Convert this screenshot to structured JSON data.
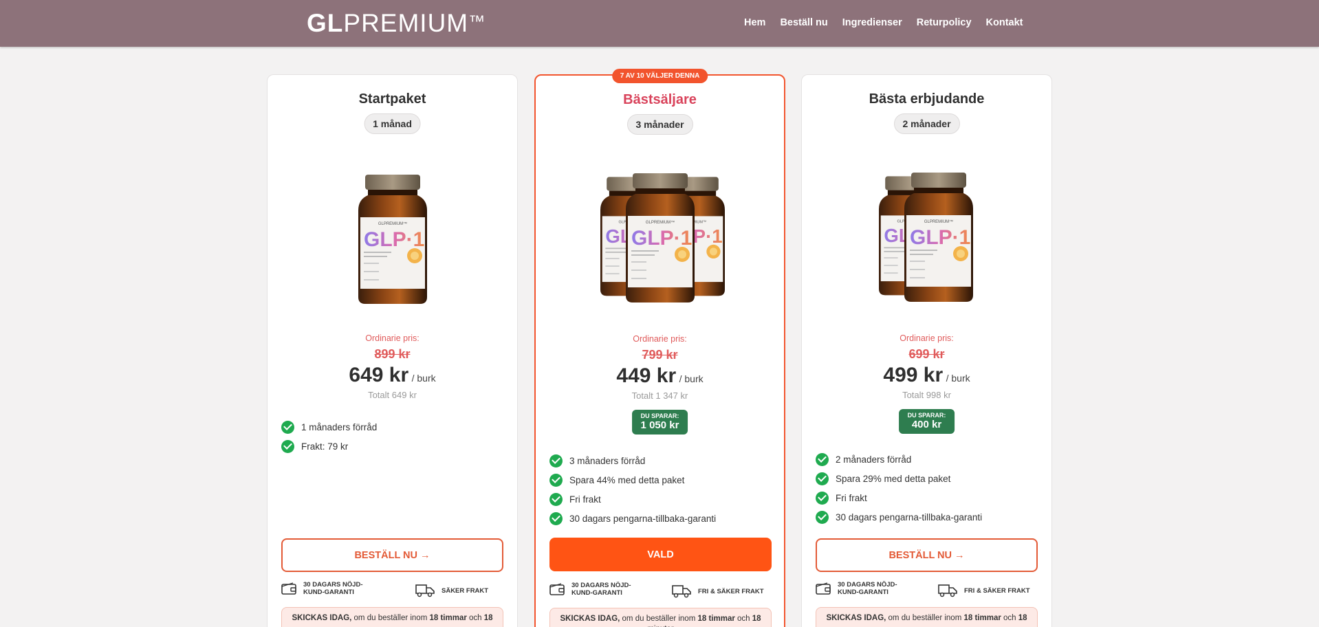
{
  "header": {
    "logo_bold": "GL",
    "logo_light": "PREMIUM",
    "logo_tm": "™",
    "nav": [
      "Hem",
      "Beställ nu",
      "Ingredienser",
      "Returpolicy",
      "Kontakt"
    ]
  },
  "cards": [
    {
      "title": "Startpaket",
      "duration": "1 månad",
      "ordinary_label": "Ordinarie pris:",
      "ordinary_price": "899 kr",
      "price": "649 kr",
      "unit": "/ burk",
      "total": "Totalt 649 kr",
      "features": [
        "1 månaders förråd",
        "Frakt: 79 kr"
      ],
      "button": "BESTÄLL NU →",
      "trust1": "30 DAGARS NÖJD-KUND-GARANTI",
      "trust2": "SÄKER FRAKT",
      "ship_strong": "SKICKAS IDAG,",
      "ship_text": " om du beställer inom ",
      "ship_hours": "18 timmar",
      "ship_and": " och ",
      "ship_min": "18"
    },
    {
      "ribbon": "7 AV 10 VÄLJER DENNA",
      "title": "Bästsäljare",
      "duration": "3 månader",
      "ordinary_label": "Ordinarie pris:",
      "ordinary_price": "799 kr",
      "price": "449 kr",
      "unit": "/ burk",
      "total": "Totalt 1 347 kr",
      "save_label": "DU SPARAR:",
      "save_value": "1 050 kr",
      "features": [
        "3 månaders förråd",
        "Spara 44% med detta paket",
        "Fri frakt",
        "30 dagars pengarna-tillbaka-garanti"
      ],
      "button": "VALD",
      "trust1": "30 DAGARS NÖJD-KUND-GARANTI",
      "trust2": "FRI & SÄKER FRAKT",
      "ship_strong": "SKICKAS IDAG,",
      "ship_text": " om du beställer inom ",
      "ship_hours": "18 timmar",
      "ship_and": " och ",
      "ship_min": "18",
      "ship_tail": "minuter"
    },
    {
      "title": "Bästa erbjudande",
      "duration": "2 månader",
      "ordinary_label": "Ordinarie pris:",
      "ordinary_price": "699 kr",
      "price": "499 kr",
      "unit": "/ burk",
      "total": "Totalt 998 kr",
      "save_label": "DU SPARAR:",
      "save_value": "400 kr",
      "features": [
        "2 månaders förråd",
        "Spara 29% med detta paket",
        "Fri frakt",
        "30 dagars pengarna-tillbaka-garanti"
      ],
      "button": "BESTÄLL NU →",
      "trust1": "30 DAGARS NÖJD-KUND-GARANTI",
      "trust2": "FRI & SÄKER FRAKT",
      "ship_strong": "SKICKAS IDAG,",
      "ship_text": " om du beställer inom ",
      "ship_hours": "18 timmar",
      "ship_and": " och ",
      "ship_min": "18"
    }
  ],
  "product_label": {
    "brand": "GLPREMIUM™",
    "name": "GLP·1"
  },
  "colors": {
    "header": "#8d727a",
    "accent": "#ff5414",
    "featured_title": "#d9435b",
    "save_badge": "#2e7d4f",
    "check": "#1faa4f"
  }
}
